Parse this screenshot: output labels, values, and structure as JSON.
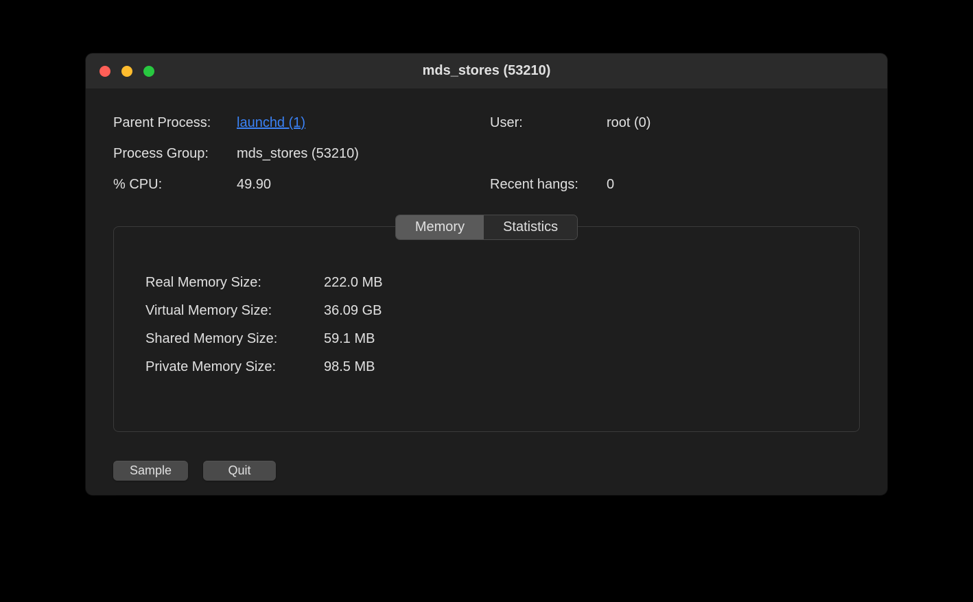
{
  "window": {
    "title": "mds_stores (53210)"
  },
  "info": {
    "parent_process_label": "Parent Process:",
    "parent_process_link": "launchd (1)",
    "user_label": "User:",
    "user_value": "root (0)",
    "process_group_label": "Process Group:",
    "process_group_value": "mds_stores (53210)",
    "cpu_label": "% CPU:",
    "cpu_value": "49.90",
    "hangs_label": "Recent hangs:",
    "hangs_value": "0"
  },
  "tabs": {
    "memory": "Memory",
    "statistics": "Statistics"
  },
  "memory": {
    "real_label": "Real Memory Size:",
    "real_value": "222.0 MB",
    "virtual_label": "Virtual Memory Size:",
    "virtual_value": "36.09 GB",
    "shared_label": "Shared Memory Size:",
    "shared_value": "59.1 MB",
    "private_label": "Private Memory Size:",
    "private_value": "98.5 MB"
  },
  "buttons": {
    "sample": "Sample",
    "quit": "Quit"
  }
}
